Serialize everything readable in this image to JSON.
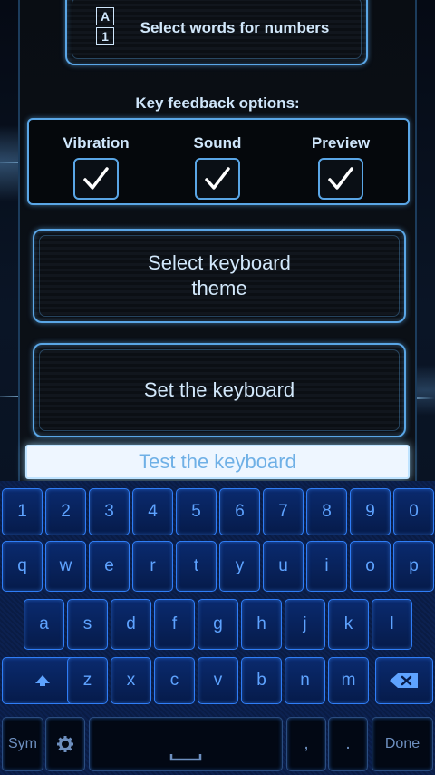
{
  "settings": {
    "numbers_button": {
      "label": "Select words for numbers",
      "icon_top": "A",
      "icon_bottom": "1"
    },
    "feedback_title": "Key feedback options:",
    "feedback_options": [
      {
        "label": "Vibration",
        "checked": true
      },
      {
        "label": "Sound",
        "checked": true
      },
      {
        "label": "Preview",
        "checked": true
      }
    ],
    "theme_button": {
      "line1": "Select keyboard",
      "line2": "theme"
    },
    "set_button": "Set the keyboard",
    "test_field_placeholder": "Test the keyboard"
  },
  "keyboard": {
    "row1": [
      "1",
      "2",
      "3",
      "4",
      "5",
      "6",
      "7",
      "8",
      "9",
      "0"
    ],
    "row2": [
      "q",
      "w",
      "e",
      "r",
      "t",
      "y",
      "u",
      "i",
      "o",
      "p"
    ],
    "row3": [
      "a",
      "s",
      "d",
      "f",
      "g",
      "h",
      "j",
      "k",
      "l"
    ],
    "row4": [
      "z",
      "x",
      "c",
      "v",
      "b",
      "n",
      "m"
    ],
    "sym_label": "Sym",
    "comma": ",",
    "period": ".",
    "done_label": "Done",
    "shift_icon": "shift-icon",
    "delete_icon": "backspace-icon",
    "settings_icon": "gear-icon",
    "space_icon": "space-icon"
  },
  "colors": {
    "accent": "#5aa6e6",
    "key_text": "#5ea3ff",
    "key_border": "#2f7df6"
  }
}
